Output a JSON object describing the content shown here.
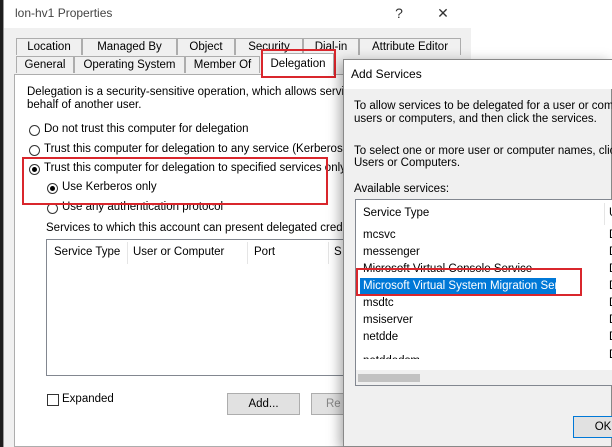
{
  "properties_window": {
    "title": "lon-hv1 Properties",
    "help_label": "?",
    "close_label": "✕",
    "tabs_row1": [
      "Location",
      "Managed By",
      "Object",
      "Security",
      "Dial-in",
      "Attribute Editor"
    ],
    "tabs_row2": [
      "General",
      "Operating System",
      "Member Of",
      "Delegation"
    ],
    "description": "Delegation is a security-sensitive operation, which allows services to act on behalf of another user.",
    "description_line1": "Delegation is a security-sensitive operation, which allows services to",
    "description_line2": "behalf of another user.",
    "options": [
      "Do not trust this computer for delegation",
      "Trust this computer for delegation to any service (Kerberos only)",
      "Trust this computer for delegation to specified services only"
    ],
    "sub_options": [
      "Use Kerberos only",
      "Use any authentication protocol"
    ],
    "services_label": "Services to which this account can present delegated credenti",
    "columns": [
      "Service Type",
      "User or Computer",
      "Port",
      "S"
    ],
    "expanded_label": "Expanded",
    "add_button": "Add...",
    "remove_button": "Re"
  },
  "add_services": {
    "title": "Add Services",
    "instructions": "To allow services to be delegated for a user or computer, select the users or computers, and then click the services.",
    "instructions_line1": "To allow services to be delegated for a user or compute",
    "instructions_line2": "users or computers, and then click the services.",
    "select_line1": "To select one or more user or computer names, click",
    "select_line2": "Users or Computers.",
    "available_label": "Available services:",
    "columns": [
      "Service Type",
      "U"
    ],
    "services": [
      {
        "name": "mcsvc",
        "user": "D"
      },
      {
        "name": "messenger",
        "user": "D"
      },
      {
        "name": "Microsoft Virtual Console Service",
        "user": "D"
      },
      {
        "name": "Microsoft Virtual System Migration Service",
        "user": "D"
      },
      {
        "name": "msdtc",
        "user": "D"
      },
      {
        "name": "msiserver",
        "user": "D"
      },
      {
        "name": "netdde",
        "user": "D"
      },
      {
        "name": "netddedsm",
        "user": "D"
      }
    ],
    "selected_service": "Microsoft Virtual System Migration Service",
    "ok_button": "OK"
  },
  "colors": {
    "highlight_box": "#d9262c",
    "selection": "#0078d7"
  }
}
